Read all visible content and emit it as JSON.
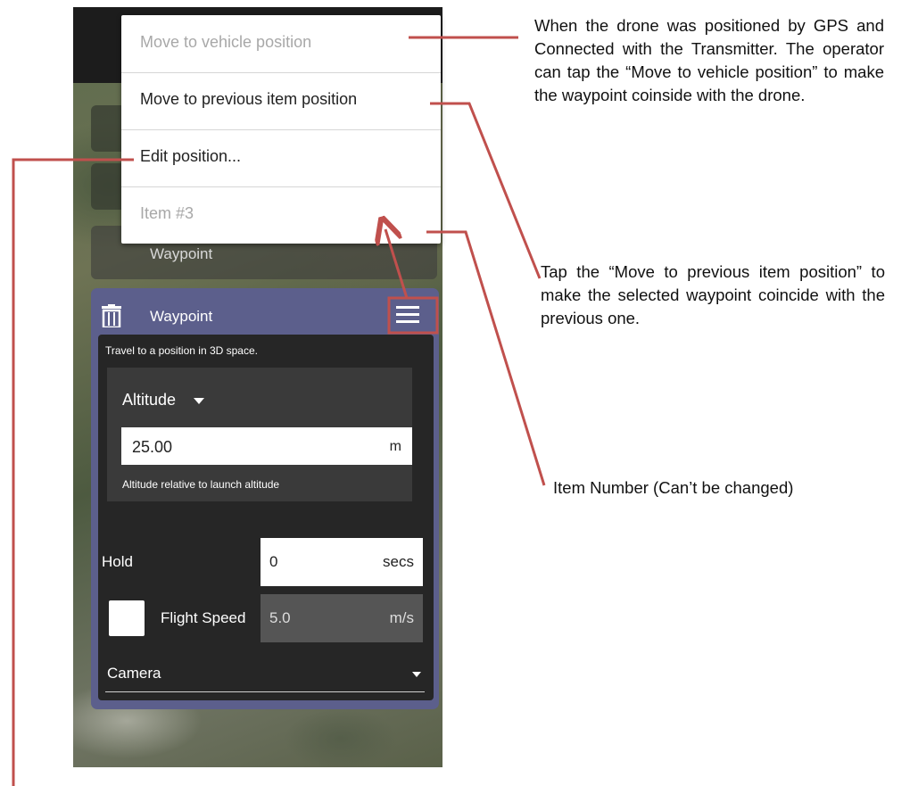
{
  "menu": {
    "items": [
      {
        "label": "Move to vehicle position",
        "enabled": false
      },
      {
        "label": "Move to previous item position",
        "enabled": true
      },
      {
        "label": "Edit position...",
        "enabled": true
      },
      {
        "label": "Item #3",
        "enabled": false
      }
    ]
  },
  "mission_item": {
    "label": "Waypoint"
  },
  "editor": {
    "title": "Waypoint",
    "description": "Travel to a position in 3D space.",
    "altitude": {
      "mode_label": "Altitude",
      "value": "25.00",
      "unit": "m",
      "help": "Altitude relative to launch altitude"
    },
    "hold": {
      "label": "Hold",
      "value": "0",
      "unit": "secs"
    },
    "flight_speed": {
      "label": "Flight Speed",
      "value": "5.0",
      "unit": "m/s",
      "checked": false
    },
    "camera": {
      "label": "Camera"
    }
  },
  "annotations": {
    "vehicle_position": "When the drone was positioned by GPS and Connected with the Transmitter. The operator can tap the “Move to vehicle position” to make the waypoint coinside with the drone.",
    "previous_item": "Tap the “Move to previous item position” to make the selected waypoint coincide with the previous one.",
    "item_number": "Item Number (Can’t be changed)"
  },
  "colors": {
    "callout": "#c0504d",
    "panel": "#5c5f8c",
    "panel_body": "#262626",
    "menu_disabled_text": "#a8a8a8"
  },
  "icons": [
    "trash-icon",
    "hamburger-menu-icon",
    "dropdown-caret-icon"
  ]
}
